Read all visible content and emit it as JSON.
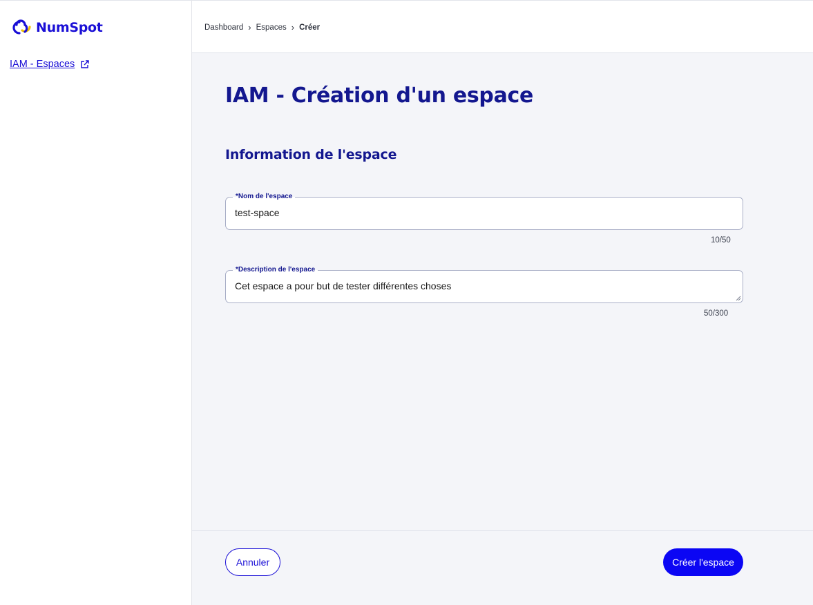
{
  "brand": {
    "name": "NumSpot",
    "primary_color": "#1a0fd6",
    "accent_color": "#f2c200"
  },
  "sidebar": {
    "link_label": "IAM - Espaces",
    "link_icon": "external-link-icon"
  },
  "breadcrumb": {
    "items": [
      "Dashboard",
      "Espaces"
    ],
    "current": "Créer"
  },
  "page": {
    "title": "IAM - Création d'un espace",
    "section_title": "Information de l'espace"
  },
  "form": {
    "name_field": {
      "label": "*Nom de l'espace",
      "value": "test-space",
      "counter": "10/50"
    },
    "description_field": {
      "label": "*Description de l'espace",
      "value": "Cet espace a pour but de tester différentes choses",
      "counter": "50/300"
    }
  },
  "footer": {
    "cancel_label": "Annuler",
    "submit_label": "Créer l'espace"
  }
}
